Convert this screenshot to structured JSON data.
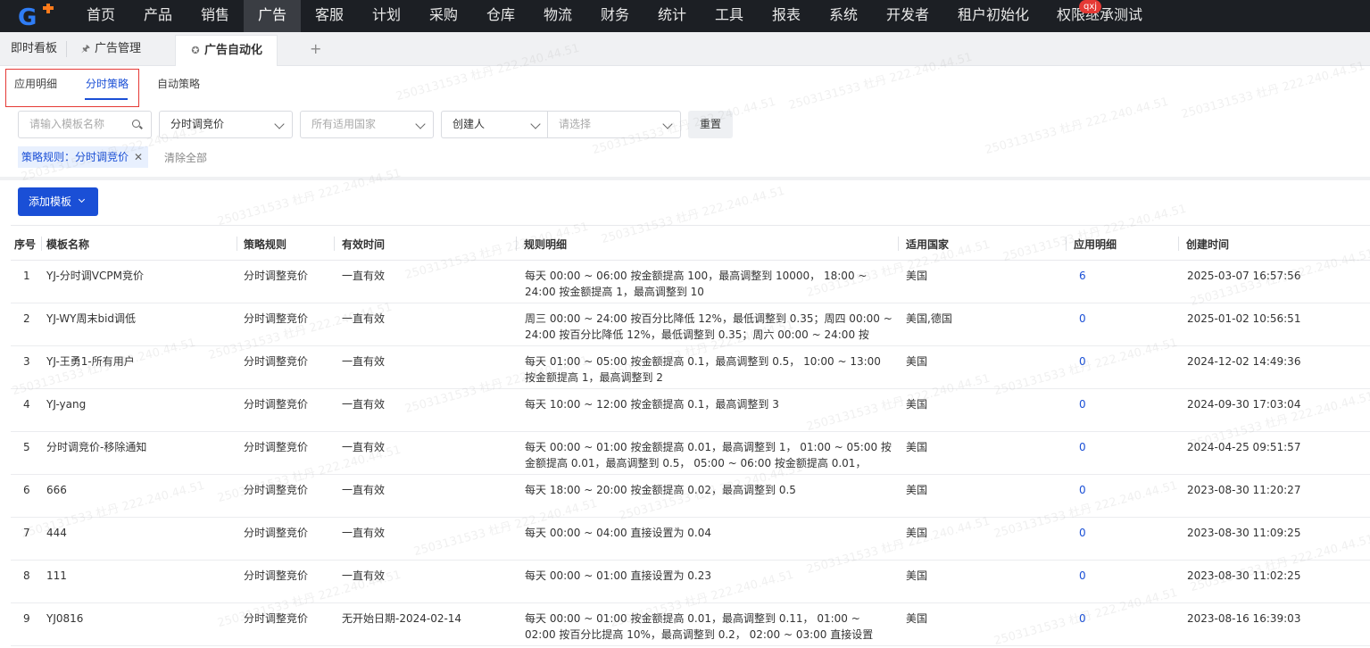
{
  "topnav": {
    "items": [
      "首页",
      "产品",
      "销售",
      "广告",
      "客服",
      "计划",
      "采购",
      "仓库",
      "物流",
      "财务",
      "统计",
      "工具",
      "报表",
      "系统",
      "开发者",
      "租户初始化",
      "权限继承测试"
    ],
    "active_index": 3,
    "user_badge": "qxj",
    "logo_letter": "G"
  },
  "page_tabs": [
    {
      "label": "即时看板"
    },
    {
      "label": "广告管理"
    },
    {
      "label": "广告自动化"
    }
  ],
  "add_tab_symbol": "+",
  "sub_tabs": [
    "应用明细",
    "分时策略",
    "自动策略"
  ],
  "filters": {
    "template_name_placeholder": "请输入模板名称",
    "strategy_rule_value": "分时调竞价",
    "country_placeholder": "所有适用国家",
    "creator_label": "创建人",
    "creator_placeholder": "请选择",
    "reset_label": "重置"
  },
  "active_tag": "策略规则：分时调竞价",
  "clear_all_label": "清除全部",
  "add_template_label": "添加模板",
  "table": {
    "headers": [
      "序号",
      "模板名称",
      "策略规则",
      "有效时间",
      "规则明细",
      "适用国家",
      "应用明细",
      "创建时间"
    ],
    "rows": [
      {
        "no": "1",
        "name": "YJ-分时调VCPM竞价",
        "rule": "分时调整竞价",
        "valid": "一直有效",
        "detail": "每天 00:00 ~ 06:00 按金额提高 100，最高调整到 10000， 18:00 ~ 24:00 按金额提高 1，最高调整到 10",
        "country": "美国",
        "applied": "6",
        "created": "2025-03-07 16:57:56"
      },
      {
        "no": "2",
        "name": "YJ-WY周末bid调低",
        "rule": "分时调整竞价",
        "valid": "一直有效",
        "detail": "周三 00:00 ~ 24:00 按百分比降低 12%，最低调整到 0.35；周四 00:00 ~ 24:00 按百分比降低 12%，最低调整到 0.35；周六 00:00 ~ 24:00 按",
        "country": "美国,德国",
        "applied": "0",
        "created": "2025-01-02 10:56:51"
      },
      {
        "no": "3",
        "name": "YJ-王勇1-所有用户",
        "rule": "分时调整竞价",
        "valid": "一直有效",
        "detail": "每天 01:00 ~ 05:00 按金额提高 0.1，最高调整到 0.5， 10:00 ~ 13:00 按金额提高 1，最高调整到 2",
        "country": "美国",
        "applied": "0",
        "created": "2024-12-02 14:49:36"
      },
      {
        "no": "4",
        "name": "YJ-yang",
        "rule": "分时调整竞价",
        "valid": "一直有效",
        "detail": "每天 10:00 ~ 12:00 按金额提高 0.1，最高调整到 3",
        "country": "美国",
        "applied": "0",
        "created": "2024-09-30 17:03:04"
      },
      {
        "no": "5",
        "name": "分时调竞价-移除通知",
        "rule": "分时调整竞价",
        "valid": "一直有效",
        "detail": "每天 00:00 ~ 01:00 按金额提高 0.01，最高调整到 1， 01:00 ~ 05:00 按金额提高 0.01，最高调整到 0.5， 05:00 ~ 06:00 按金额提高 0.01，",
        "country": "美国",
        "applied": "0",
        "created": "2024-04-25 09:51:57"
      },
      {
        "no": "6",
        "name": "666",
        "rule": "分时调整竞价",
        "valid": "一直有效",
        "detail": "每天 18:00 ~ 20:00 按金额提高 0.02，最高调整到 0.5",
        "country": "美国",
        "applied": "0",
        "created": "2023-08-30 11:20:27"
      },
      {
        "no": "7",
        "name": "444",
        "rule": "分时调整竞价",
        "valid": "一直有效",
        "detail": "每天 00:00 ~ 04:00 直接设置为 0.04",
        "country": "美国",
        "applied": "0",
        "created": "2023-08-30 11:09:25"
      },
      {
        "no": "8",
        "name": "111",
        "rule": "分时调整竞价",
        "valid": "一直有效",
        "detail": "每天 00:00 ~ 01:00 直接设置为 0.23",
        "country": "美国",
        "applied": "0",
        "created": "2023-08-30 11:02:25"
      },
      {
        "no": "9",
        "name": "YJ0816",
        "rule": "分时调整竞价",
        "valid": "无开始日期-2024-02-14",
        "detail": "每天 00:00 ~ 01:00 按金额提高 0.01，最高调整到 0.11， 01:00 ~ 02:00 按百分比提高 10%，最高调整到 0.2， 02:00 ~ 03:00 直接设置",
        "country": "美国",
        "applied": "0",
        "created": "2023-08-16 16:39:03"
      }
    ]
  },
  "watermark": "2503131533 杜丹 222.240.44.51",
  "colors": {
    "accent": "#1a4fd6",
    "nav_bg": "#1c1f24",
    "highlight_box": "#e53935"
  }
}
